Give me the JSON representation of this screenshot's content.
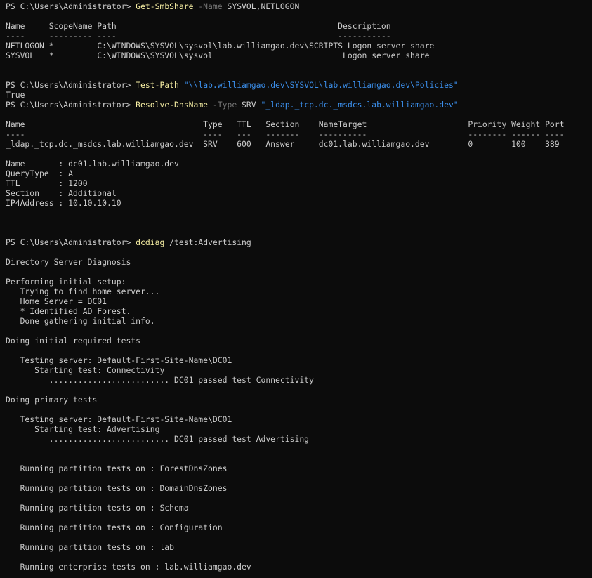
{
  "terminal": {
    "colors": {
      "background": "#0c0c0c",
      "default": "#cccccc",
      "cmd": "#f9f1a5",
      "param": "#767676",
      "string": "#3b8eea"
    },
    "lines": [
      [
        {
          "t": "PS C:\\Users\\Administrator> ",
          "c": "default"
        },
        {
          "t": "Get-SmbShare",
          "c": "cmd"
        },
        {
          "t": " -Name",
          "c": "param"
        },
        {
          "t": " SYSVOL,NETLOGON",
          "c": "default"
        }
      ],
      [],
      [
        {
          "t": "Name     ScopeName Path                                              Description",
          "c": "default"
        }
      ],
      [
        {
          "t": "----     --------- ----                                              -----------",
          "c": "default"
        }
      ],
      [
        {
          "t": "NETLOGON *         C:\\WINDOWS\\SYSVOL\\sysvol\\lab.williamgao.dev\\SCRIPTS Logon server share",
          "c": "default"
        }
      ],
      [
        {
          "t": "SYSVOL   *         C:\\WINDOWS\\SYSVOL\\sysvol                           Logon server share",
          "c": "default"
        }
      ],
      [],
      [],
      [
        {
          "t": "PS C:\\Users\\Administrator> ",
          "c": "default"
        },
        {
          "t": "Test-Path",
          "c": "cmd"
        },
        {
          "t": " \"\\\\lab.williamgao.dev\\SYSVOL\\lab.williamgao.dev\\Policies\"",
          "c": "string"
        }
      ],
      [
        {
          "t": "True",
          "c": "default"
        }
      ],
      [
        {
          "t": "PS C:\\Users\\Administrator> ",
          "c": "default"
        },
        {
          "t": "Resolve-DnsName",
          "c": "cmd"
        },
        {
          "t": " -Type",
          "c": "param"
        },
        {
          "t": " SRV ",
          "c": "default"
        },
        {
          "t": "\"_ldap._tcp.dc._msdcs.lab.williamgao.dev\"",
          "c": "string"
        }
      ],
      [],
      [
        {
          "t": "Name                                     Type   TTL   Section    NameTarget                     Priority Weight Port",
          "c": "default"
        }
      ],
      [
        {
          "t": "----                                     ----   ---   -------    ----------                     -------- ------ ----",
          "c": "default"
        }
      ],
      [
        {
          "t": "_ldap._tcp.dc._msdcs.lab.williamgao.dev  SRV    600   Answer     dc01.lab.williamgao.dev        0        100    389",
          "c": "default"
        }
      ],
      [],
      [
        {
          "t": "Name       : dc01.lab.williamgao.dev",
          "c": "default"
        }
      ],
      [
        {
          "t": "QueryType  : A",
          "c": "default"
        }
      ],
      [
        {
          "t": "TTL        : 1200",
          "c": "default"
        }
      ],
      [
        {
          "t": "Section    : Additional",
          "c": "default"
        }
      ],
      [
        {
          "t": "IP4Address : 10.10.10.10",
          "c": "default"
        }
      ],
      [],
      [],
      [],
      [
        {
          "t": "PS C:\\Users\\Administrator> ",
          "c": "default"
        },
        {
          "t": "dcdiag",
          "c": "cmd"
        },
        {
          "t": " /test:Advertising",
          "c": "default"
        }
      ],
      [],
      [
        {
          "t": "Directory Server Diagnosis",
          "c": "default"
        }
      ],
      [],
      [
        {
          "t": "Performing initial setup:",
          "c": "default"
        }
      ],
      [
        {
          "t": "   Trying to find home server...",
          "c": "default"
        }
      ],
      [
        {
          "t": "   Home Server = DC01",
          "c": "default"
        }
      ],
      [
        {
          "t": "   * Identified AD Forest.",
          "c": "default"
        }
      ],
      [
        {
          "t": "   Done gathering initial info.",
          "c": "default"
        }
      ],
      [],
      [
        {
          "t": "Doing initial required tests",
          "c": "default"
        }
      ],
      [],
      [
        {
          "t": "   Testing server: Default-First-Site-Name\\DC01",
          "c": "default"
        }
      ],
      [
        {
          "t": "      Starting test: Connectivity",
          "c": "default"
        }
      ],
      [
        {
          "t": "         ......................... DC01 passed test Connectivity",
          "c": "default"
        }
      ],
      [],
      [
        {
          "t": "Doing primary tests",
          "c": "default"
        }
      ],
      [],
      [
        {
          "t": "   Testing server: Default-First-Site-Name\\DC01",
          "c": "default"
        }
      ],
      [
        {
          "t": "      Starting test: Advertising",
          "c": "default"
        }
      ],
      [
        {
          "t": "         ......................... DC01 passed test Advertising",
          "c": "default"
        }
      ],
      [],
      [],
      [
        {
          "t": "   Running partition tests on : ForestDnsZones",
          "c": "default"
        }
      ],
      [],
      [
        {
          "t": "   Running partition tests on : DomainDnsZones",
          "c": "default"
        }
      ],
      [],
      [
        {
          "t": "   Running partition tests on : Schema",
          "c": "default"
        }
      ],
      [],
      [
        {
          "t": "   Running partition tests on : Configuration",
          "c": "default"
        }
      ],
      [],
      [
        {
          "t": "   Running partition tests on : lab",
          "c": "default"
        }
      ],
      [],
      [
        {
          "t": "   Running enterprise tests on : lab.williamgao.dev",
          "c": "default"
        }
      ]
    ]
  }
}
